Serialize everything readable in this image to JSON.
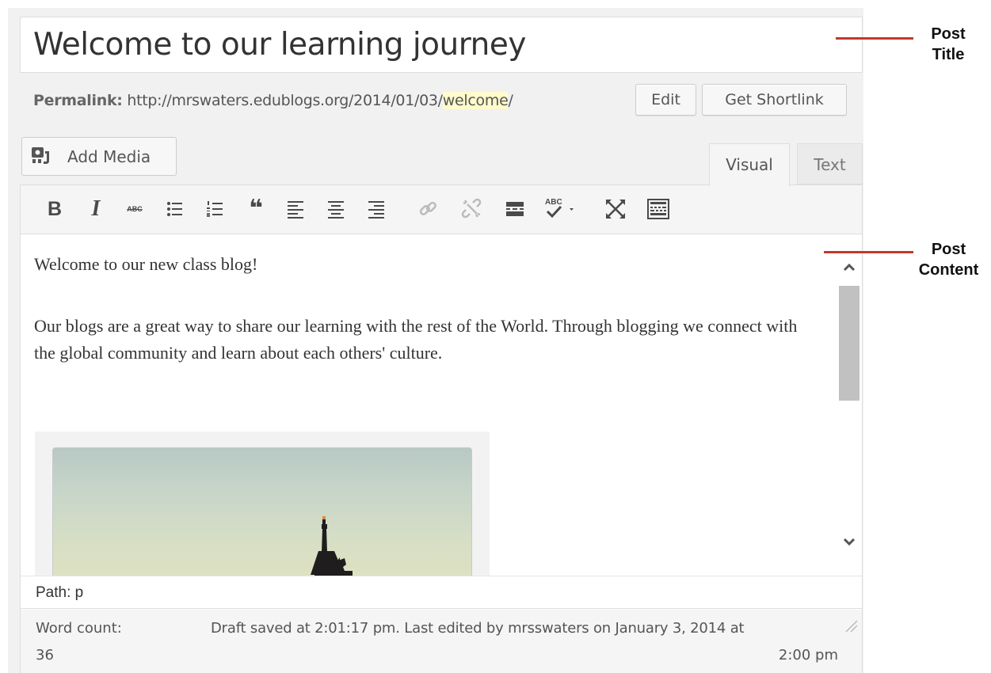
{
  "post": {
    "title": "Welcome to our learning journey",
    "permalink_label": "Permalink:",
    "permalink_base": "http://mrswaters.edublogs.org/2014/01/03/",
    "permalink_slug": "welcome",
    "permalink_trailing": "/",
    "edit_label": "Edit",
    "shortlink_label": "Get Shortlink"
  },
  "media": {
    "add_media_label": "Add Media",
    "icon": "media-icon"
  },
  "tabs": [
    {
      "label": "Visual",
      "active": true
    },
    {
      "label": "Text",
      "active": false
    }
  ],
  "toolbar": {
    "icons": [
      "bold-icon",
      "italic-icon",
      "strikethrough-icon",
      "bullet-list-icon",
      "numbered-list-icon",
      "blockquote-icon",
      "align-left-icon",
      "align-center-icon",
      "align-right-icon",
      "link-icon",
      "unlink-icon",
      "read-more-icon",
      "spellcheck-icon",
      "fullscreen-icon",
      "toolbar-toggle-icon"
    ],
    "bold_glyph": "B",
    "italic_glyph": "I",
    "strike_glyph": "ABC",
    "quote_glyph": "❝",
    "spell_glyph": "ABC"
  },
  "content": {
    "paragraph_1": "Welcome to our new class blog!",
    "paragraph_2": "Our blogs are a great way to share our learning with the rest of the World. Through blogging we connect with the global community and learn about each others' culture."
  },
  "path_bar": {
    "text": "Path: p"
  },
  "status_bar": {
    "word_count_label": "Word count:",
    "word_count_value": "36",
    "draft_line_1": "Draft saved at 2:01:17 pm. Last edited by mrsswaters on January 3, 2014 at",
    "draft_line_2": "2:00 pm"
  },
  "annotations": {
    "post_title": "Post Title",
    "post_content": "Post Content",
    "line_color": "#c0392b"
  }
}
